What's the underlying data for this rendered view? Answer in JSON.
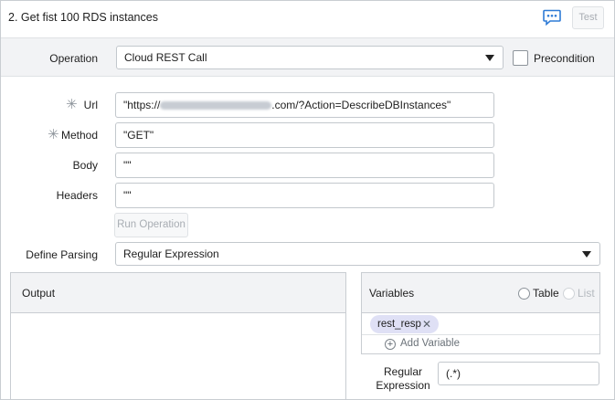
{
  "header": {
    "title": "2. Get fist 100 RDS instances",
    "test_label": "Test"
  },
  "operation": {
    "label": "Operation",
    "value": "Cloud REST Call",
    "precondition_label": "Precondition"
  },
  "url": {
    "label": "Url",
    "value_prefix": "\"https://",
    "value_suffix": ".com/?Action=DescribeDBInstances\""
  },
  "method": {
    "label": "Method",
    "value": "\"GET\""
  },
  "body": {
    "label": "Body",
    "value": "\"\""
  },
  "headers": {
    "label": "Headers",
    "value": "\"\""
  },
  "run_operation_label": "Run Operation",
  "parsing": {
    "label": "Define Parsing",
    "value": "Regular Expression"
  },
  "output": {
    "title": "Output"
  },
  "variables": {
    "title": "Variables",
    "table_label": "Table",
    "list_label": "List",
    "items": [
      {
        "name": "rest_resp"
      }
    ],
    "add_label": "Add Variable"
  },
  "regex": {
    "label_line1": "Regular",
    "label_line2": "Expression",
    "value": "(.*)"
  }
}
